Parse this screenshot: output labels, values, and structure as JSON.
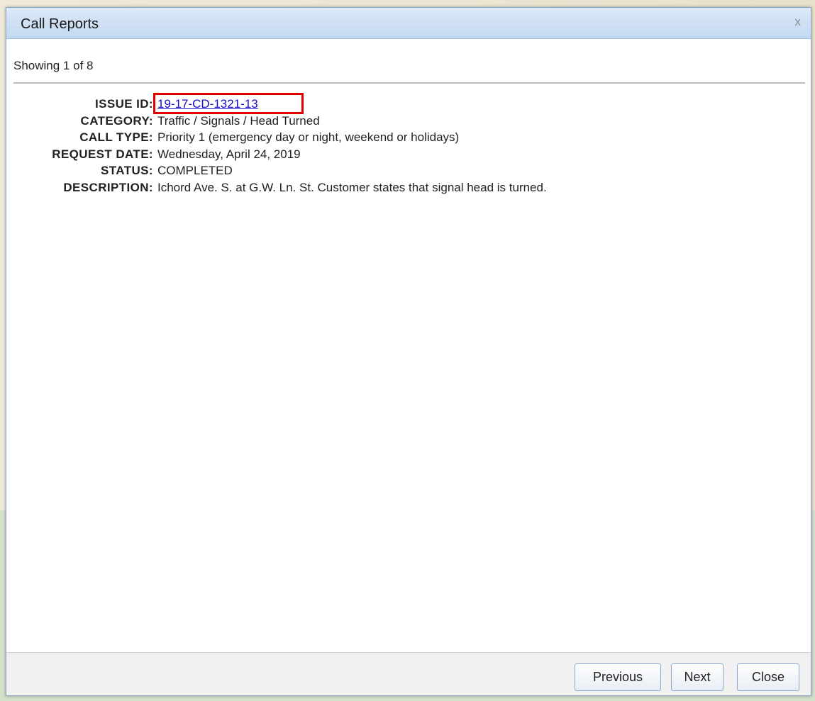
{
  "dialog": {
    "title": "Call Reports",
    "close_glyph": "x",
    "showing": "Showing 1 of 8"
  },
  "fields": [
    {
      "label": "ISSUE ID:",
      "value": "19-17-CD-1321-13"
    },
    {
      "label": "CATEGORY:",
      "value": "Traffic / Signals / Head Turned"
    },
    {
      "label": "CALL TYPE:",
      "value": "Priority 1 (emergency day or night, weekend or holidays)"
    },
    {
      "label": "REQUEST DATE:",
      "value": "Wednesday, April 24, 2019"
    },
    {
      "label": "STATUS:",
      "value": "COMPLETED"
    },
    {
      "label": "DESCRIPTION:",
      "value": "Ichord Ave. S. at G.W. Ln. St. Customer states that signal head is turned."
    }
  ],
  "footer": {
    "previous_label": "Previous",
    "next_label": "Next",
    "close_label": "Close"
  },
  "colors": {
    "link": "#1a0dcc",
    "highlight": "#e00000",
    "titlebar": "#c3d8f1"
  }
}
